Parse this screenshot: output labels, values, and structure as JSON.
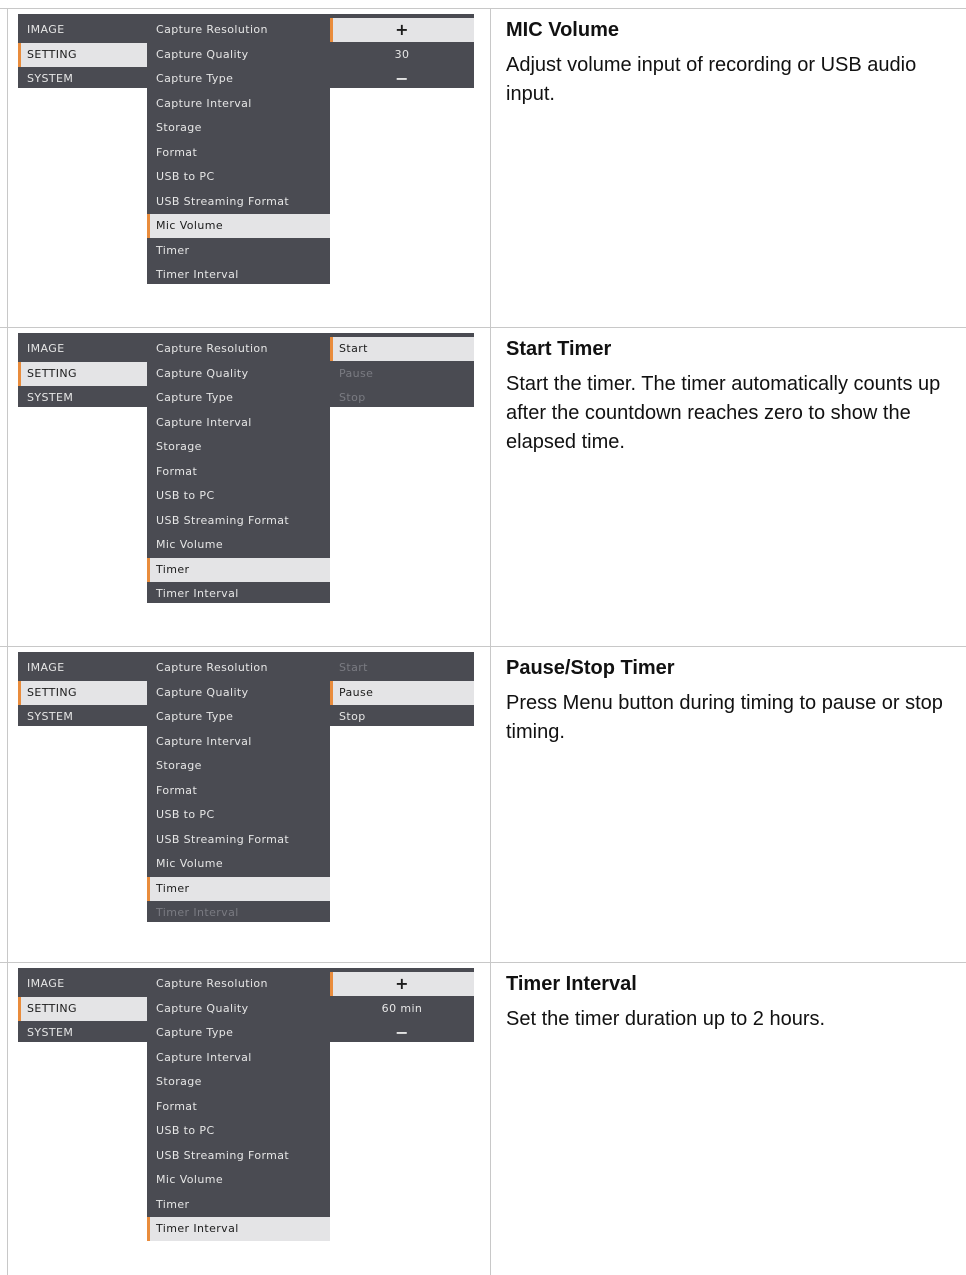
{
  "menu": {
    "left": [
      "IMAGE",
      "SETTING",
      "SYSTEM"
    ],
    "middle": [
      "Capture Resolution",
      "Capture Quality",
      "Capture Type",
      "Capture Interval",
      "Storage",
      "Format",
      "USB to PC",
      "USB Streaming Format",
      "Mic Volume",
      "Timer",
      "Timer Interval"
    ]
  },
  "rows": [
    {
      "title": "MIC Volume",
      "body": "Adjust volume input of recording or USB audio input.",
      "right": [
        "+",
        "30",
        "−"
      ]
    },
    {
      "title": "Start Timer",
      "body": "Start the timer. The timer automatically counts up after the countdown reaches zero to show the elapsed time.",
      "right": [
        "Start",
        "Pause",
        "Stop"
      ]
    },
    {
      "title": "Pause/Stop Timer",
      "body": "Press Menu button during timing to pause or stop timing.",
      "right": [
        "Start",
        "Pause",
        "Stop"
      ]
    },
    {
      "title": "Timer Interval",
      "body": "Set the timer duration up to 2 hours.",
      "right": [
        "+",
        "60 min",
        "−"
      ]
    }
  ],
  "colors": {
    "menu_bg": "#4a4b52",
    "selected_bg": "#e4e4e6",
    "accent": "#e98c3c",
    "dim_text": "#7a7b82"
  }
}
